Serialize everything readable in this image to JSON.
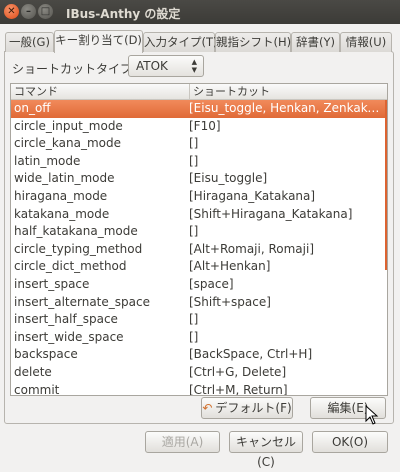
{
  "window": {
    "title": "IBus-Anthy の設定"
  },
  "tabs": [
    {
      "label": "一般(G)"
    },
    {
      "label": "キー割り当て(D)"
    },
    {
      "label": "入力タイプ(T)"
    },
    {
      "label": "親指シフト(H)"
    },
    {
      "label": "辞書(Y)"
    },
    {
      "label": "情報(U)"
    }
  ],
  "shortcut": {
    "label": "ショートカットタイプ(S):",
    "value": "ATOK"
  },
  "list": {
    "headers": {
      "command": "コマンド",
      "shortcut": "ショートカット"
    },
    "rows": [
      {
        "command": "on_off",
        "shortcut": "[Eisu_toggle, Henkan, Zenkaku_Hankaku]"
      },
      {
        "command": "circle_input_mode",
        "shortcut": "[F10]"
      },
      {
        "command": "circle_kana_mode",
        "shortcut": "[]"
      },
      {
        "command": "latin_mode",
        "shortcut": "[]"
      },
      {
        "command": "wide_latin_mode",
        "shortcut": "[Eisu_toggle]"
      },
      {
        "command": "hiragana_mode",
        "shortcut": "[Hiragana_Katakana]"
      },
      {
        "command": "katakana_mode",
        "shortcut": "[Shift+Hiragana_Katakana]"
      },
      {
        "command": "half_katakana_mode",
        "shortcut": "[]"
      },
      {
        "command": "circle_typing_method",
        "shortcut": "[Alt+Romaji, Romaji]"
      },
      {
        "command": "circle_dict_method",
        "shortcut": "[Alt+Henkan]"
      },
      {
        "command": "insert_space",
        "shortcut": "[space]"
      },
      {
        "command": "insert_alternate_space",
        "shortcut": "[Shift+space]"
      },
      {
        "command": "insert_half_space",
        "shortcut": "[]"
      },
      {
        "command": "insert_wide_space",
        "shortcut": "[]"
      },
      {
        "command": "backspace",
        "shortcut": "[BackSpace, Ctrl+H]"
      },
      {
        "command": "delete",
        "shortcut": "[Ctrl+G, Delete]"
      },
      {
        "command": "commit",
        "shortcut": "[Ctrl+M, Return]"
      }
    ]
  },
  "buttons": {
    "default": "デフォルト(F)",
    "edit": "編集(E)",
    "apply": "適用(A)",
    "cancel": "キャンセル(C)",
    "ok": "OK(O)"
  },
  "colors": {
    "selection": "#e06a37",
    "titlebar": "#3c3b37"
  }
}
